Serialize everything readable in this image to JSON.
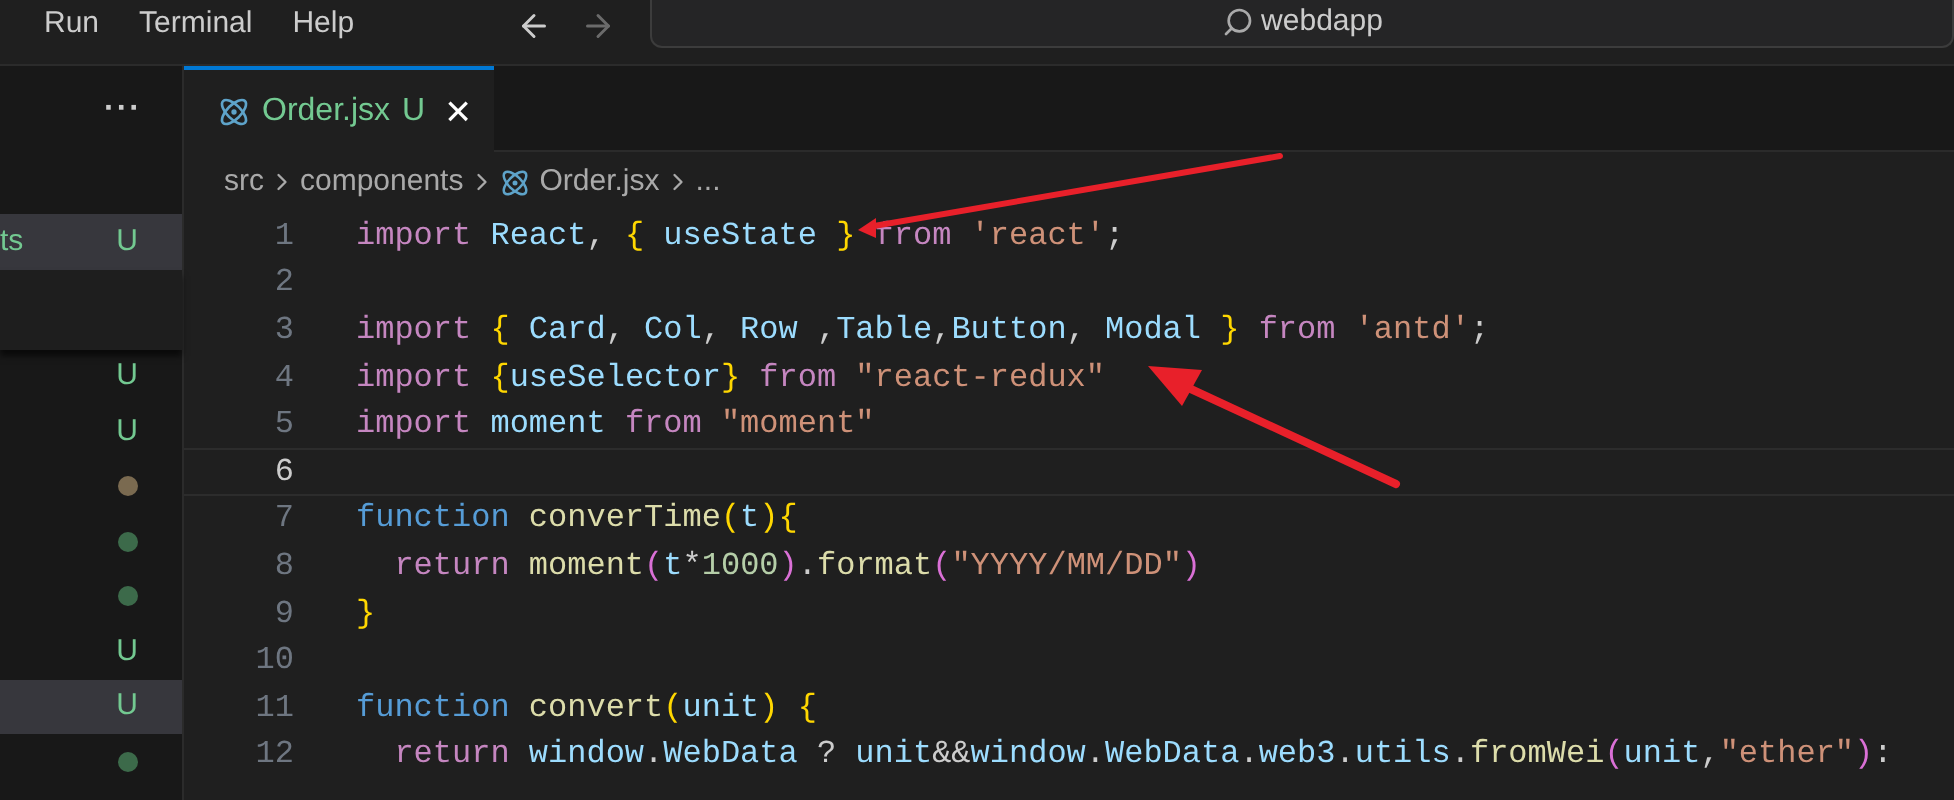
{
  "menu_bar": {
    "items": [
      "Run",
      "Terminal",
      "Help"
    ]
  },
  "command_center": {
    "value": "webdapp"
  },
  "explorer": {
    "more": "···",
    "rows": [
      {
        "label": "ts",
        "kind": "letter",
        "badge": "U",
        "selected": true
      },
      {
        "kind": "letter",
        "badge": "U",
        "selected": false
      },
      {
        "kind": "letter",
        "badge": "U",
        "selected": false
      },
      {
        "kind": "dot",
        "color": "#7a6a50",
        "selected": false
      },
      {
        "kind": "dot",
        "color": "#3c6a4a",
        "selected": false
      },
      {
        "kind": "dot",
        "color": "#3c6a4a",
        "selected": false
      },
      {
        "kind": "letter",
        "badge": "U",
        "selected": false
      },
      {
        "kind": "letter",
        "badge": "U",
        "selected": true
      },
      {
        "kind": "dot",
        "color": "#3c6a4a",
        "selected": false
      }
    ]
  },
  "tab": {
    "label": "Order.jsx",
    "badge": "U",
    "close": "×"
  },
  "breadcrumb": [
    "src",
    "components",
    "Order.jsx",
    "..."
  ],
  "editor": {
    "lines": [
      {
        "number": "1",
        "current": false,
        "tokens": [
          {
            "kind": "kw",
            "text": "import "
          },
          {
            "kind": "id",
            "text": "React"
          },
          {
            "kind": "p",
            "text": ", "
          },
          {
            "kind": "b1",
            "text": "{ "
          },
          {
            "kind": "id",
            "text": "useState "
          },
          {
            "kind": "b1",
            "text": "} "
          },
          {
            "kind": "kw",
            "text": "from "
          },
          {
            "kind": "str",
            "text": "'react'"
          },
          {
            "kind": "p",
            "text": ";"
          }
        ]
      },
      {
        "number": "2",
        "current": false
      },
      {
        "number": "3",
        "current": false,
        "tokens": [
          {
            "kind": "kw",
            "text": "import "
          },
          {
            "kind": "b1",
            "text": "{ "
          },
          {
            "kind": "id",
            "text": "Card"
          },
          {
            "kind": "p",
            "text": ", "
          },
          {
            "kind": "id",
            "text": "Col"
          },
          {
            "kind": "p",
            "text": ", "
          },
          {
            "kind": "id",
            "text": "Row "
          },
          {
            "kind": "p",
            "text": ","
          },
          {
            "kind": "id",
            "text": "Table"
          },
          {
            "kind": "p",
            "text": ","
          },
          {
            "kind": "id",
            "text": "Button"
          },
          {
            "kind": "p",
            "text": ", "
          },
          {
            "kind": "id",
            "text": "Modal "
          },
          {
            "kind": "b1",
            "text": "} "
          },
          {
            "kind": "kw",
            "text": "from "
          },
          {
            "kind": "str",
            "text": "'antd'"
          },
          {
            "kind": "p",
            "text": ";"
          }
        ]
      },
      {
        "number": "4",
        "current": false,
        "tokens": [
          {
            "kind": "kw",
            "text": "import "
          },
          {
            "kind": "b1",
            "text": "{"
          },
          {
            "kind": "id",
            "text": "useSelector"
          },
          {
            "kind": "b1",
            "text": "} "
          },
          {
            "kind": "kw",
            "text": "from "
          },
          {
            "kind": "str",
            "text": "\"react-redux\""
          }
        ]
      },
      {
        "number": "5",
        "current": false,
        "tokens": [
          {
            "kind": "kw",
            "text": "import "
          },
          {
            "kind": "id",
            "text": "moment "
          },
          {
            "kind": "kw",
            "text": "from "
          },
          {
            "kind": "str",
            "text": "\"moment\""
          }
        ]
      },
      {
        "number": "6",
        "current": true
      },
      {
        "number": "7",
        "current": false,
        "tokens": [
          {
            "kind": "dec",
            "text": "function "
          },
          {
            "kind": "fn",
            "text": "converTime"
          },
          {
            "kind": "b1",
            "text": "("
          },
          {
            "kind": "id",
            "text": "t"
          },
          {
            "kind": "b1",
            "text": ")"
          },
          {
            "kind": "b1",
            "text": "{"
          }
        ]
      },
      {
        "number": "8",
        "current": false,
        "tokens": [
          {
            "kind": "kw",
            "text": "  return "
          },
          {
            "kind": "fn",
            "text": "moment"
          },
          {
            "kind": "b2",
            "text": "("
          },
          {
            "kind": "id",
            "text": "t"
          },
          {
            "kind": "p",
            "text": "*"
          },
          {
            "kind": "num",
            "text": "1000"
          },
          {
            "kind": "b2",
            "text": ")"
          },
          {
            "kind": "p",
            "text": "."
          },
          {
            "kind": "fn",
            "text": "format"
          },
          {
            "kind": "b2",
            "text": "("
          },
          {
            "kind": "str",
            "text": "\"YYYY/MM/DD\""
          },
          {
            "kind": "b2",
            "text": ")"
          }
        ]
      },
      {
        "number": "9",
        "current": false,
        "tokens": [
          {
            "kind": "b1",
            "text": "}"
          }
        ]
      },
      {
        "number": "10",
        "current": false
      },
      {
        "number": "11",
        "current": false,
        "tokens": [
          {
            "kind": "dec",
            "text": "function "
          },
          {
            "kind": "fn",
            "text": "convert"
          },
          {
            "kind": "b1",
            "text": "("
          },
          {
            "kind": "id",
            "text": "unit"
          },
          {
            "kind": "b1",
            "text": ") {"
          }
        ]
      },
      {
        "number": "12",
        "current": false,
        "tokens": [
          {
            "kind": "kw",
            "text": "  return "
          },
          {
            "kind": "id",
            "text": "window"
          },
          {
            "kind": "p",
            "text": "."
          },
          {
            "kind": "id",
            "text": "WebData"
          },
          {
            "kind": "p",
            "text": " ? "
          },
          {
            "kind": "id",
            "text": "unit"
          },
          {
            "kind": "p",
            "text": "&&"
          },
          {
            "kind": "id",
            "text": "window"
          },
          {
            "kind": "p",
            "text": "."
          },
          {
            "kind": "id",
            "text": "WebData"
          },
          {
            "kind": "p",
            "text": "."
          },
          {
            "kind": "id",
            "text": "web3"
          },
          {
            "kind": "p",
            "text": "."
          },
          {
            "kind": "id",
            "text": "utils"
          },
          {
            "kind": "p",
            "text": "."
          },
          {
            "kind": "fn",
            "text": "fromWei"
          },
          {
            "kind": "b2",
            "text": "("
          },
          {
            "kind": "id",
            "text": "unit"
          },
          {
            "kind": "p",
            "text": ","
          },
          {
            "kind": "str",
            "text": "\"ether\""
          },
          {
            "kind": "b2",
            "text": ")"
          },
          {
            "kind": "p",
            "text": ":"
          }
        ]
      }
    ]
  }
}
